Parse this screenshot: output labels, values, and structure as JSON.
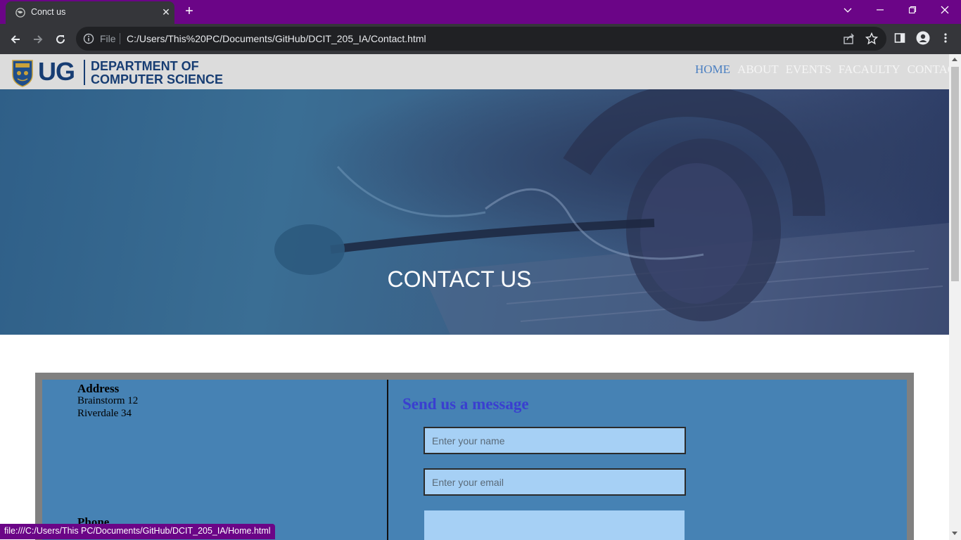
{
  "browser": {
    "tab_title": "Conct us",
    "scheme_label": "File",
    "url": "C:/Users/This%20PC/Documents/GitHub/DCIT_205_IA/Contact.html",
    "status_url": "file:///C:/Users/This PC/Documents/GitHub/DCIT_205_IA/Home.html",
    "colors": {
      "tabbar": "#6b0587",
      "toolbar": "#35363a"
    }
  },
  "header": {
    "logo_short": "UG",
    "dept_line1": "DEPARTMENT OF",
    "dept_line2": "COMPUTER SCIENCE",
    "nav": [
      "HOME",
      "ABOUT",
      "EVENTS",
      "FACAULTY",
      "CONTACT"
    ],
    "active_nav": "HOME"
  },
  "hero": {
    "title": "CONTACT US"
  },
  "contact": {
    "address_heading": "Address",
    "address_lines": [
      "Brainstorm 12",
      "Riverdale 34"
    ],
    "phone_heading": "Phone",
    "form_heading": "Send us a message",
    "name_placeholder": "Enter your name",
    "email_placeholder": "Enter your email",
    "colors": {
      "panel": "#4682b4",
      "frame": "#808080",
      "input": "#a6d0f5",
      "heading": "#3a3fd0"
    }
  }
}
